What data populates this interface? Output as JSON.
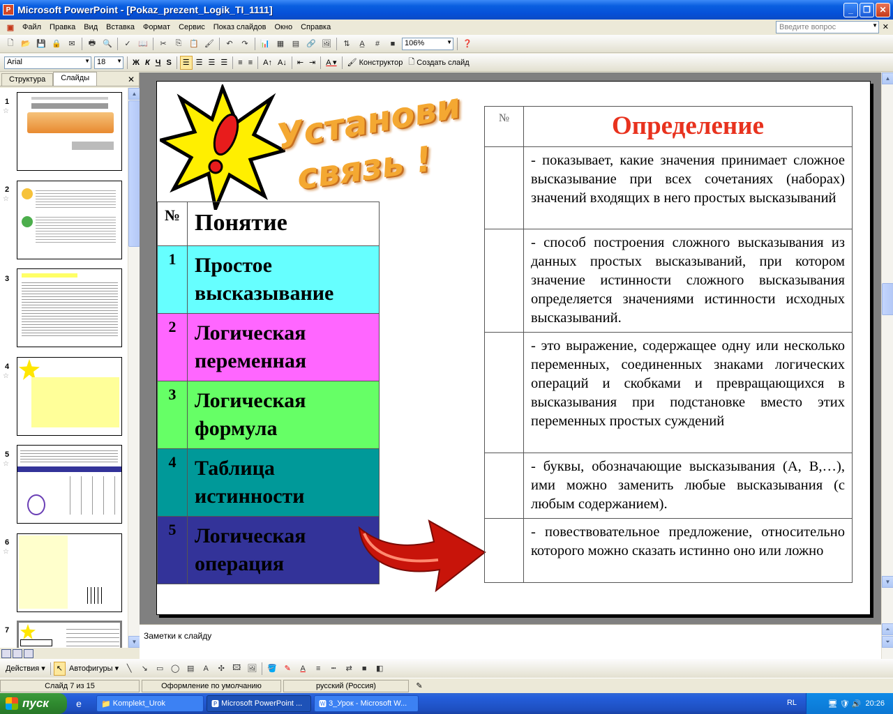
{
  "window": {
    "title": "Microsoft PowerPoint - [Pokaz_prezent_Logik_TI_1111]"
  },
  "menu": [
    "Файл",
    "Правка",
    "Вид",
    "Вставка",
    "Формат",
    "Сервис",
    "Показ слайдов",
    "Окно",
    "Справка"
  ],
  "ask_placeholder": "Введите вопрос",
  "toolbar": {
    "zoom": "106%"
  },
  "format_toolbar": {
    "font": "Arial",
    "size": "18",
    "bold": "Ж",
    "italic": "К",
    "underline": "Ч",
    "shadow": "S",
    "designer": "Конструктор",
    "new_slide": "Создать слайд"
  },
  "left_panel": {
    "tab_outline": "Структура",
    "tab_slides": "Слайды",
    "slide_numbers": [
      "1",
      "2",
      "3",
      "4",
      "5",
      "6",
      "7"
    ]
  },
  "slide": {
    "wordart_1": "Установи",
    "wordart_2": "связь !",
    "left_table": {
      "header": {
        "num": "№",
        "term": "Понятие"
      },
      "rows": [
        {
          "num": "1",
          "term": "Простое высказывание",
          "color": "#66ffff"
        },
        {
          "num": "2",
          "term": "Логическая переменная",
          "color": "#ff66ff"
        },
        {
          "num": "3",
          "term": "Логическая формула",
          "color": "#66ff66"
        },
        {
          "num": "4",
          "term": "Таблица истинности",
          "color": "#009999"
        },
        {
          "num": "5",
          "term": "Логическая операция",
          "color": "#333399"
        }
      ]
    },
    "right_table": {
      "header": {
        "num": "№",
        "def": "Определение"
      },
      "rows": [
        {
          "def": "- показывает, какие значения принимает сложное высказывание при всех сочетаниях (наборах) значений входящих в него простых высказываний"
        },
        {
          "def": "- способ построения сложного высказывания из данных простых высказываний, при котором значение истинности сложного высказывания определяется значениями истинности исходных высказываний."
        },
        {
          "def": "- это выражение, содержащее одну или несколько переменных, соединенных знаками логических операций и скобками и превращающихся в высказывания при подстановке вместо этих переменных простых суждений"
        },
        {
          "def": "- буквы, обозначающие высказывания (А, В,…), ими можно заменить любые высказывания (с любым содержанием)."
        },
        {
          "def": "- повествовательное предложение, относительно которого можно сказать истинно оно или ложно"
        }
      ]
    }
  },
  "notes_placeholder": "Заметки к слайду",
  "draw_toolbar": {
    "actions": "Действия",
    "autoshapes": "Автофигуры"
  },
  "status": {
    "slide": "Слайд 7 из 15",
    "design": "Оформление по умолчанию",
    "language": "русский (Россия)"
  },
  "taskbar": {
    "start": "пуск",
    "tasks": [
      "Komplekt_Urok",
      "Microsoft PowerPoint ...",
      "3_Урок - Microsoft W..."
    ],
    "lang": "RL",
    "time": "20:26"
  },
  "colors": {
    "accent_red": "#e8321e",
    "xp_blue": "#0a5fe0"
  }
}
